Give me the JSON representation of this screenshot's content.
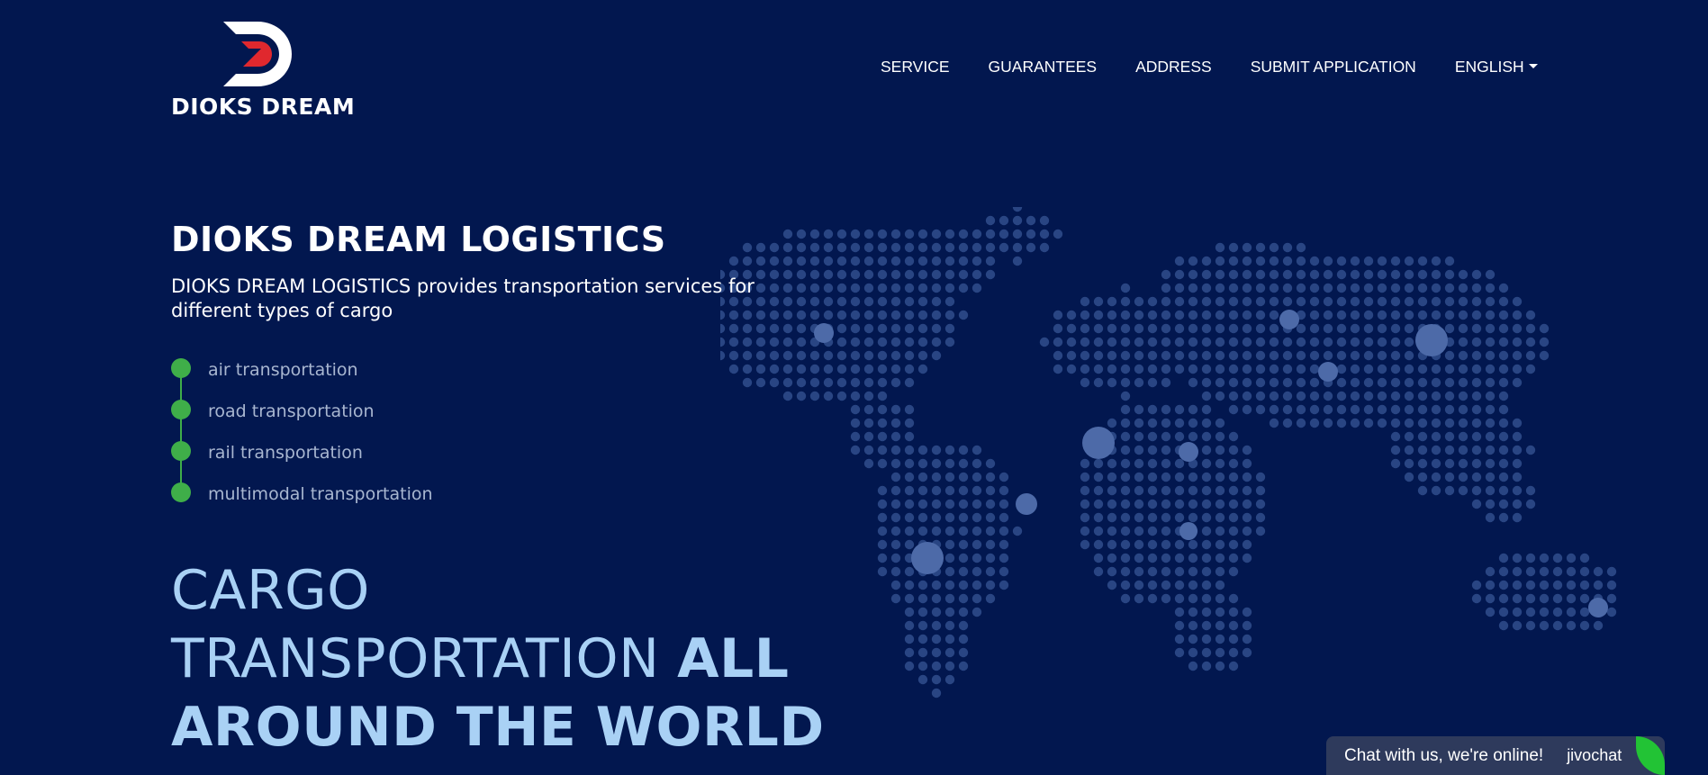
{
  "brand": {
    "name": "DIOKS DREAM",
    "colors": {
      "primary": "#ffffff",
      "accent_red": "#e0282e",
      "background": "#02174f"
    }
  },
  "nav": {
    "items": [
      {
        "label": "SERVICE"
      },
      {
        "label": "GUARANTEES"
      },
      {
        "label": "ADDRESS"
      },
      {
        "label": "SUBMIT APPLICATION"
      }
    ],
    "language": {
      "label": "ENGLISH",
      "icon": "caret-down-icon"
    }
  },
  "hero": {
    "title": "DIOKS DREAM LOGISTICS",
    "subtitle": "DIOKS DREAM LOGISTICS provides transportation services for different types of cargo",
    "services": [
      {
        "label": "air transportation"
      },
      {
        "label": "road transportation"
      },
      {
        "label": "rail transportation"
      },
      {
        "label": "multimodal transportation"
      }
    ],
    "tagline": {
      "line1": "CARGO",
      "line2_light": "TRANSPORTATION",
      "line2_bold": "ALL",
      "line3_bold": "AROUND THE WORLD"
    },
    "bullet_color": "#3fae49",
    "map_icon": "world-map-dots"
  },
  "chat": {
    "text": "Chat with us, we're online!",
    "brand": "jivochat",
    "accent": "#22c335"
  }
}
